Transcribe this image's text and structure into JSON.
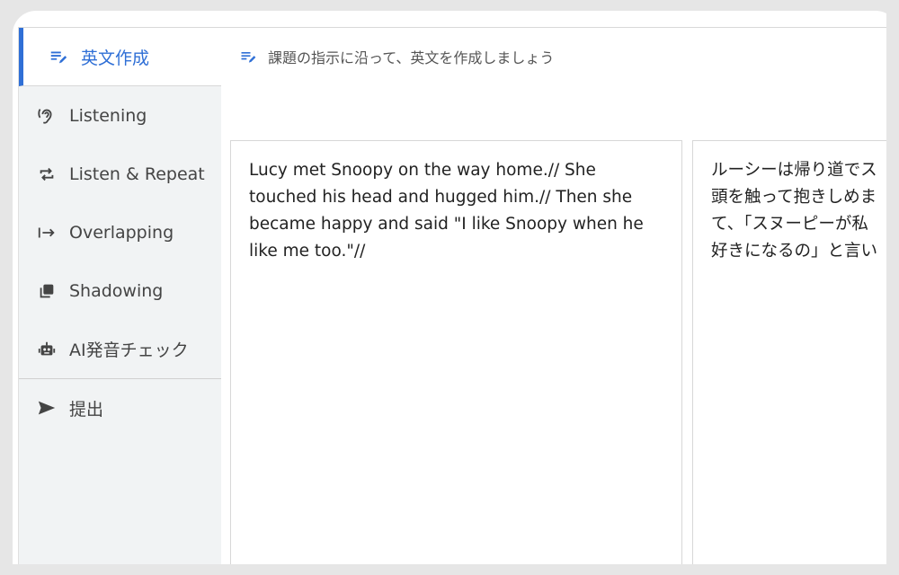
{
  "sidebar": {
    "items": [
      {
        "label": "英文作成",
        "icon": "edit-note-icon",
        "active": true
      },
      {
        "label": "Listening",
        "icon": "ear-icon"
      },
      {
        "label": "Listen & Repeat",
        "icon": "repeat-icon"
      },
      {
        "label": "Overlapping",
        "icon": "arrow-to-line-icon"
      },
      {
        "label": "Shadowing",
        "icon": "copy-stack-icon"
      },
      {
        "label": "AI発音チェック",
        "icon": "robot-icon"
      },
      {
        "label": "提出",
        "icon": "send-icon"
      }
    ]
  },
  "main": {
    "instruction": "課題の指示に沿って、英文を作成しましょう",
    "english_text": "Lucy met Snoopy on the way home.// She touched his head and hugged him.// Then she became happy and said \"I like Snoopy when he like me too.\"//",
    "japanese_lines": [
      "ルーシーは帰り道でス",
      "頭を触って抱きしめま",
      "て、「スヌーピーが私",
      "好きになるの」と言い"
    ]
  },
  "colors": {
    "accent": "#2f6fd6",
    "sidebar_bg": "#f1f3f4",
    "frame": "#e6e6e6"
  }
}
